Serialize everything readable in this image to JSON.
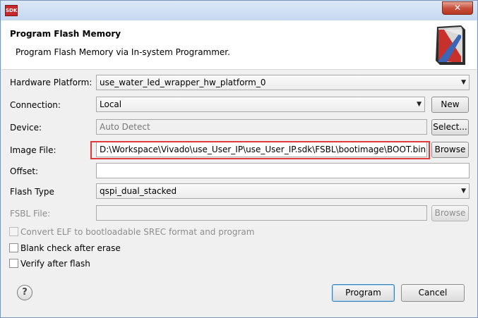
{
  "window": {
    "app_icon_text": "SDK",
    "close_glyph": "✕"
  },
  "header": {
    "title": "Program Flash Memory",
    "description": "Program Flash Memory via In-system Programmer."
  },
  "form": {
    "hardware_platform": {
      "label": "Hardware Platform:",
      "value": "use_water_led_wrapper_hw_platform_0"
    },
    "connection": {
      "label": "Connection:",
      "value": "Local",
      "new_label": "New"
    },
    "device": {
      "label": "Device:",
      "value": "Auto Detect",
      "select_label": "Select..."
    },
    "image_file": {
      "label": "Image File:",
      "value": "D:\\Workspace\\Vivado\\use_User_IP\\use_User_IP.sdk\\FSBL\\bootimage\\BOOT.bin",
      "browse_label": "Browse"
    },
    "offset": {
      "label": "Offset:",
      "value": ""
    },
    "flash_type": {
      "label": "Flash Type",
      "value": "qspi_dual_stacked"
    },
    "fsbl_file": {
      "label": "FSBL File:",
      "value": "",
      "browse_label": "Browse"
    }
  },
  "options": {
    "convert_elf": {
      "label": "Convert ELF to bootloadable SREC format and program",
      "checked": false,
      "enabled": false
    },
    "blank_check": {
      "label": "Blank check after erase",
      "checked": false
    },
    "verify": {
      "label": "Verify after flash",
      "checked": false
    }
  },
  "footer": {
    "help_glyph": "?",
    "program_label": "Program",
    "cancel_label": "Cancel"
  },
  "colors": {
    "highlight": "#e03a3a",
    "title_bar": "#c6d8f0",
    "close_button": "#c7513e"
  }
}
